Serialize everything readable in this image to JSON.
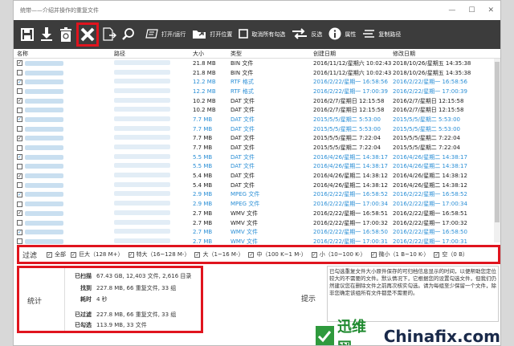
{
  "window": {
    "title": "统带——介绍并操作的重复文件",
    "controls": [
      "—",
      "☐",
      "✕"
    ]
  },
  "toolbar": {
    "buttons": [
      {
        "label": "打开/运行"
      },
      {
        "label": "打开位置"
      },
      {
        "label": "取消所有勾选"
      },
      {
        "label": "反选"
      },
      {
        "label": "属性"
      },
      {
        "label": "复制路径"
      }
    ]
  },
  "table": {
    "headers": {
      "name": "名称",
      "path": "路径",
      "size": "大小",
      "type": "类型",
      "created": "创建日期",
      "modified": "修改日期"
    },
    "rows": [
      {
        "checked": true,
        "size": "21.8 MB",
        "type": "BIN 文件",
        "created": "2016/11/12/星期六 10:02:43",
        "modified": "2018/10/26/星期五 14:35:38",
        "blue": false
      },
      {
        "checked": false,
        "size": "21.8 MB",
        "type": "BIN 文件",
        "created": "2016/11/12/星期六 10:02:43",
        "modified": "2018/10/26/星期五 14:35:38",
        "blue": false
      },
      {
        "checked": true,
        "size": "12.2 MB",
        "type": "RTF 格式",
        "created": "2016/2/22/星期一 16:58:56",
        "modified": "2016/2/22/星期一 16:58:56",
        "blue": true
      },
      {
        "checked": false,
        "size": "12.2 MB",
        "type": "RTF 格式",
        "created": "2016/2/22/星期一 17:00:39",
        "modified": "2016/2/22/星期一 17:00:39",
        "blue": true
      },
      {
        "checked": true,
        "size": "10.2 MB",
        "type": "DAT 文件",
        "created": "2016/2/7/星期日 12:15:58",
        "modified": "2016/2/7/星期日 12:15:58",
        "blue": false
      },
      {
        "checked": false,
        "size": "10.2 MB",
        "type": "DAT 文件",
        "created": "2016/2/7/星期日 12:15:58",
        "modified": "2016/2/7/星期日 12:15:58",
        "blue": false
      },
      {
        "checked": true,
        "size": "7.7 MB",
        "type": "DAT 文件",
        "created": "2015/5/5/星期二 5:53:00",
        "modified": "2015/5/5/星期二 5:53:00",
        "blue": true
      },
      {
        "checked": false,
        "size": "7.7 MB",
        "type": "DAT 文件",
        "created": "2015/5/5/星期二 5:53:00",
        "modified": "2015/5/5/星期二 5:53:00",
        "blue": true
      },
      {
        "checked": true,
        "size": "7.7 MB",
        "type": "DAT 文件",
        "created": "2015/5/5/星期二 7:22:04",
        "modified": "2015/5/5/星期二 7:22:04",
        "blue": false
      },
      {
        "checked": false,
        "size": "7.7 MB",
        "type": "DAT 文件",
        "created": "2015/5/5/星期二 7:22:04",
        "modified": "2015/5/5/星期二 7:22:04",
        "blue": false
      },
      {
        "checked": true,
        "size": "5.5 MB",
        "type": "DAT 文件",
        "created": "2016/4/26/星期二 14:38:17",
        "modified": "2016/4/26/星期二 14:38:17",
        "blue": true
      },
      {
        "checked": false,
        "size": "5.5 MB",
        "type": "DAT 文件",
        "created": "2016/4/26/星期二 14:38:17",
        "modified": "2016/4/26/星期二 14:38:17",
        "blue": true
      },
      {
        "checked": true,
        "size": "5.4 MB",
        "type": "DAT 文件",
        "created": "2016/4/26/星期二 14:38:12",
        "modified": "2016/4/26/星期二 14:38:12",
        "blue": false
      },
      {
        "checked": false,
        "size": "5.4 MB",
        "type": "DAT 文件",
        "created": "2016/4/26/星期二 14:38:12",
        "modified": "2016/4/26/星期二 14:38:12",
        "blue": false
      },
      {
        "checked": true,
        "size": "2.9 MB",
        "type": "MPEG 文件",
        "created": "2016/2/22/星期一 16:58:52",
        "modified": "2016/2/22/星期一 16:58:52",
        "blue": true
      },
      {
        "checked": false,
        "size": "2.9 MB",
        "type": "MPEG 文件",
        "created": "2016/2/22/星期一 17:00:34",
        "modified": "2016/2/22/星期一 17:00:34",
        "blue": true
      },
      {
        "checked": true,
        "size": "2.7 MB",
        "type": "WMV 文件",
        "created": "2016/2/22/星期一 16:58:51",
        "modified": "2016/2/22/星期一 16:58:51",
        "blue": false
      },
      {
        "checked": false,
        "size": "2.7 MB",
        "type": "WMV 文件",
        "created": "2016/2/22/星期一 17:00:32",
        "modified": "2016/2/22/星期一 17:00:32",
        "blue": false
      },
      {
        "checked": true,
        "size": "2.7 MB",
        "type": "WMV 文件",
        "created": "2016/2/22/星期一 16:58:50",
        "modified": "2016/2/22/星期一 16:58:50",
        "blue": true
      },
      {
        "checked": false,
        "size": "2.7 MB",
        "type": "WMV 文件",
        "created": "2016/2/22/星期一 17:00:31",
        "modified": "2016/2/22/星期一 17:00:31",
        "blue": true
      }
    ]
  },
  "filter": {
    "label": "过滤",
    "options": [
      {
        "label": "全部",
        "checked": true
      },
      {
        "label": "巨大（128 M+）",
        "checked": true
      },
      {
        "label": "特大（16~128 M-）",
        "checked": true
      },
      {
        "label": "大（1~16 M-）",
        "checked": true
      },
      {
        "label": "中（100 K~1 M-）",
        "checked": true
      },
      {
        "label": "小（10~100 K-）",
        "checked": true
      },
      {
        "label": "微小（1 B~10 K-）",
        "checked": true
      },
      {
        "label": "空（0 B）",
        "checked": true
      }
    ]
  },
  "stats": {
    "label": "统计",
    "rows": [
      {
        "key": "已扫描",
        "value": "67.43 GB, 12,403 文件, 2,616 目录"
      },
      {
        "key": "找到",
        "value": "227.8 MB, 66 重复文件, 33 组"
      },
      {
        "key": "耗时",
        "value": "4 秒"
      },
      {
        "key": "已过滤",
        "value": "227.8 MB, 66 重复文件, 33 组"
      },
      {
        "key": "已勾选",
        "value": "113.9 MB, 33 文件"
      }
    ]
  },
  "hint": {
    "label": "提示",
    "text": "已勾选重复文件大小原件保存的可归档信息显示的时间，以便帮助您定位较大的不需要的文件。默认情况下，它根据您的设置勾选文件，但我们仍然建议您在删除文件之前再次核实勾选。请为每组至少保留一个文件，除非您确定该组所有文件都是不需要的。"
  },
  "watermark": {
    "brand1": "迅维网",
    "brand2": "Chinafix.com"
  }
}
